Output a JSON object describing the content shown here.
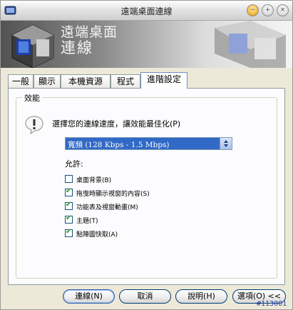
{
  "window": {
    "title": "遠端桌面連線"
  },
  "banner": {
    "line1": "遠端桌面",
    "line2": "連線"
  },
  "tabs": [
    {
      "label": "一般"
    },
    {
      "label": "顯示"
    },
    {
      "label": "本機資源"
    },
    {
      "label": "程式"
    },
    {
      "label": "進階設定"
    }
  ],
  "performance": {
    "group_title": "效能",
    "speed_label": "選擇您的連線速度，讓效能最佳化(P)",
    "speed_selected": "寬頻 (128 Kbps - 1.5 Mbps)",
    "allow_label": "允許:",
    "options": [
      {
        "label": "桌面背景(B)",
        "checked": false
      },
      {
        "label": "拖曳時顯示視窗的內容(S)",
        "checked": true
      },
      {
        "label": "功能表及視窗動畫(M)",
        "checked": true
      },
      {
        "label": "主題(T)",
        "checked": true
      },
      {
        "label": "點陣圖快取(A)",
        "checked": true
      }
    ]
  },
  "buttons": {
    "connect": "連線(N)",
    "cancel": "取消",
    "help": "說明(H)",
    "options": "選項(O) <<"
  },
  "stamp": "#113001"
}
